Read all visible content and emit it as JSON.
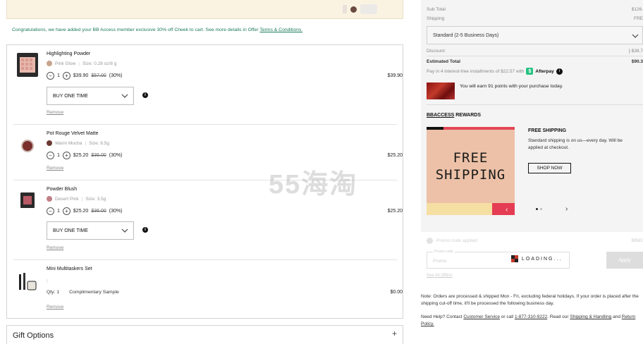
{
  "congrats": {
    "text": "Congratulations, we have added your BB Access member exclusive 30% off Cheek to cart. See more details in Offer ",
    "link": "Terms & Conditions."
  },
  "items": [
    {
      "name": "Highlighting Powder",
      "shade": "Pink Glow",
      "size": "Size: 0.28 oz/8 g",
      "qty": "1",
      "price": "$39.90",
      "original": "$57.00",
      "discount": "(30%)",
      "total": "$39.90",
      "purchase_option": "BUY ONE TIME",
      "remove": "Remove"
    },
    {
      "name": "Pot Rouge Velvet Matte",
      "shade": "Warm Mocha",
      "size": "Size: 6.5g",
      "qty": "1",
      "price": "$25.20",
      "original": "$36.00",
      "discount": "(30%)",
      "total": "$25.20",
      "remove": "Remove"
    },
    {
      "name": "Powder Blush",
      "shade": "Desert Pink",
      "size": "Size: 3.5g",
      "qty": "1",
      "price": "$25.20",
      "original": "$36.00",
      "discount": "(30%)",
      "total": "$25.20",
      "purchase_option": "BUY ONE TIME",
      "remove": "Remove"
    },
    {
      "name": "Mini Multitaskers Set",
      "qty_label": "Qty: 1",
      "sample_label": "Complimentary Sample",
      "total": "$0.00",
      "remove": "Remove"
    }
  ],
  "gift_options": {
    "label": "Gift Options",
    "toggle": "+"
  },
  "watermark": "55海淘",
  "summary": {
    "subtotal_label": "Sub Total",
    "subtotal_value": "$126.",
    "shipping_label": "Shipping",
    "shipping_value": "FRE",
    "shipping_option": "Standard (2-5 Business Days)",
    "discount_label": "Discount:",
    "discount_value": "[-$38.7",
    "estimated_label": "Estimated Total",
    "estimated_value": "$90.3",
    "afterpay_text": "Pay in 4 interest-free installments of $22.57 with",
    "afterpay_brand": "Afterpay",
    "points_text": "You will earn 91 points with your purchase today."
  },
  "rewards": {
    "title_underlined": "BBACCESS",
    "title_rest": " REWARDS",
    "card_line1": "FREE",
    "card_line2": "SHIPPING",
    "offer_title": "FREE SHIPPING",
    "offer_desc": "Standard shipping is on us—every day. Will be applied at checkout.",
    "shop_now": "SHOP NOW"
  },
  "promo_code": {
    "applied_label": "Promo code applied",
    "right_code": "BBM2",
    "input_floating_label": "Promo code",
    "input_value": "Promo",
    "loading": "LOADING...",
    "apply": "Apply",
    "see_all": "See All Offers"
  },
  "note": "Note: Orders are processed & shipped Mon - Fri, excluding federal holidays. If your order is placed after the shipping cut-off time, it'll be processed the following business day.",
  "help": {
    "prefix": "Need Help? Contact ",
    "customer_service": "Customer Service",
    "middle": " or call ",
    "phone": "1-877-310-9222",
    "read": ". Read our ",
    "shipping_link": "Shipping & Handling",
    "and": " and ",
    "return_link": "Return Policy."
  },
  "colors": {
    "accent_green": "#1b7a5a",
    "afterpay_green": "#26c281",
    "promo_peach": "#ecc1a7",
    "promo_red": "#e34656"
  }
}
